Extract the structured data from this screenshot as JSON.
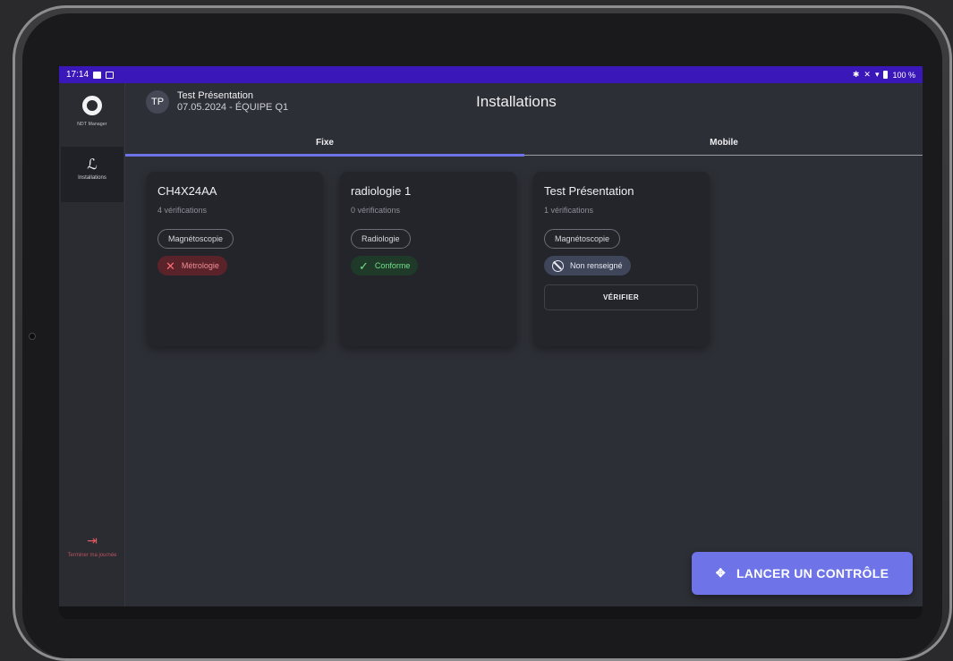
{
  "status_bar": {
    "time": "17:14",
    "battery": "100 %",
    "icons": [
      "bluetooth-icon",
      "mute-icon",
      "wifi-icon",
      "battery-icon"
    ]
  },
  "rail": {
    "logo_text": "NDT Manager",
    "items": [
      {
        "label": "Installations",
        "icon": "installations-icon"
      }
    ],
    "logout_label": "Terminer ma journée"
  },
  "header": {
    "avatar_initials": "TP",
    "user_name": "Test Présentation",
    "user_sub": "07.05.2024 - ÉQUIPE Q1",
    "title": "Installations"
  },
  "tabs": [
    {
      "label": "Fixe",
      "active": true
    },
    {
      "label": "Mobile",
      "active": false
    }
  ],
  "cards": [
    {
      "title": "CH4X24AA",
      "subtitle": "4 vérifications",
      "category": "Magnétoscopie",
      "status": "Métrologie",
      "status_type": "error"
    },
    {
      "title": "radiologie 1",
      "subtitle": "0 vérifications",
      "category": "Radiologie",
      "status": "Conforme",
      "status_type": "ok"
    },
    {
      "title": "Test Présentation",
      "subtitle": "1 vérifications",
      "category": "Magnétoscopie",
      "status": "Non renseigné",
      "status_type": "none",
      "action_label": "VÉRIFIER"
    }
  ],
  "fab": {
    "label": "LANCER UN CONTRÔLE"
  },
  "colors": {
    "status_bar": "#3a17b8",
    "accent": "#6e74e8",
    "background": "#2d2f36",
    "card": "#23252b",
    "error": "#ff6b75",
    "success": "#6fe28b"
  }
}
